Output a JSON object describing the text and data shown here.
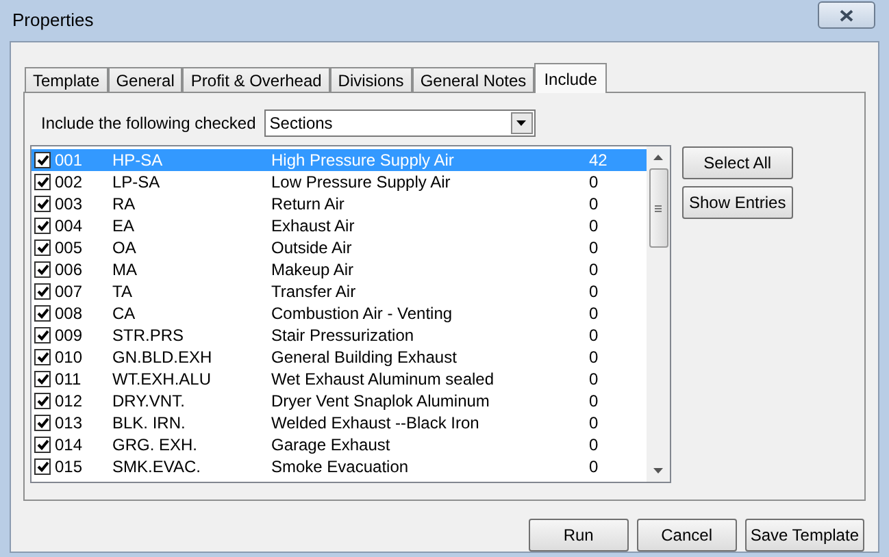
{
  "window": {
    "title": "Properties"
  },
  "tabs": [
    {
      "label": "Template",
      "selected": false
    },
    {
      "label": "General",
      "selected": false
    },
    {
      "label": "Profit & Overhead",
      "selected": false
    },
    {
      "label": "Divisions",
      "selected": false
    },
    {
      "label": "General Notes",
      "selected": false
    },
    {
      "label": "Include",
      "selected": true
    }
  ],
  "include_label": "Include the following checked",
  "include_combo": {
    "value": "Sections"
  },
  "rows": [
    {
      "checked": true,
      "selected": true,
      "number": "001",
      "code": "HP-SA",
      "description": "High Pressure Supply Air",
      "count": "42"
    },
    {
      "checked": true,
      "selected": false,
      "number": "002",
      "code": "LP-SA",
      "description": "Low Pressure Supply Air",
      "count": "0"
    },
    {
      "checked": true,
      "selected": false,
      "number": "003",
      "code": "RA",
      "description": "Return Air",
      "count": "0"
    },
    {
      "checked": true,
      "selected": false,
      "number": "004",
      "code": "EA",
      "description": "Exhaust Air",
      "count": "0"
    },
    {
      "checked": true,
      "selected": false,
      "number": "005",
      "code": "OA",
      "description": "Outside Air",
      "count": "0"
    },
    {
      "checked": true,
      "selected": false,
      "number": "006",
      "code": "MA",
      "description": "Makeup Air",
      "count": "0"
    },
    {
      "checked": true,
      "selected": false,
      "number": "007",
      "code": "TA",
      "description": "Transfer Air",
      "count": "0"
    },
    {
      "checked": true,
      "selected": false,
      "number": "008",
      "code": "CA",
      "description": "Combustion Air - Venting",
      "count": "0"
    },
    {
      "checked": true,
      "selected": false,
      "number": "009",
      "code": "STR.PRS",
      "description": "Stair Pressurization",
      "count": "0"
    },
    {
      "checked": true,
      "selected": false,
      "number": "010",
      "code": "GN.BLD.EXH",
      "description": "General Building Exhaust",
      "count": "0"
    },
    {
      "checked": true,
      "selected": false,
      "number": "011",
      "code": "WT.EXH.ALU",
      "description": "Wet Exhaust Aluminum sealed",
      "count": "0"
    },
    {
      "checked": true,
      "selected": false,
      "number": "012",
      "code": "DRY.VNT.",
      "description": "Dryer Vent Snaplok Aluminum",
      "count": "0"
    },
    {
      "checked": true,
      "selected": false,
      "number": "013",
      "code": "BLK. IRN.",
      "description": "Welded Exhaust --Black Iron",
      "count": "0"
    },
    {
      "checked": true,
      "selected": false,
      "number": "014",
      "code": "GRG. EXH.",
      "description": "Garage Exhaust",
      "count": "0"
    },
    {
      "checked": true,
      "selected": false,
      "number": "015",
      "code": "SMK.EVAC.",
      "description": "Smoke Evacuation",
      "count": "0"
    }
  ],
  "side_buttons": [
    "Select All",
    "Show Entries"
  ],
  "buttons": [
    "Run",
    "Cancel",
    "Save Template"
  ]
}
